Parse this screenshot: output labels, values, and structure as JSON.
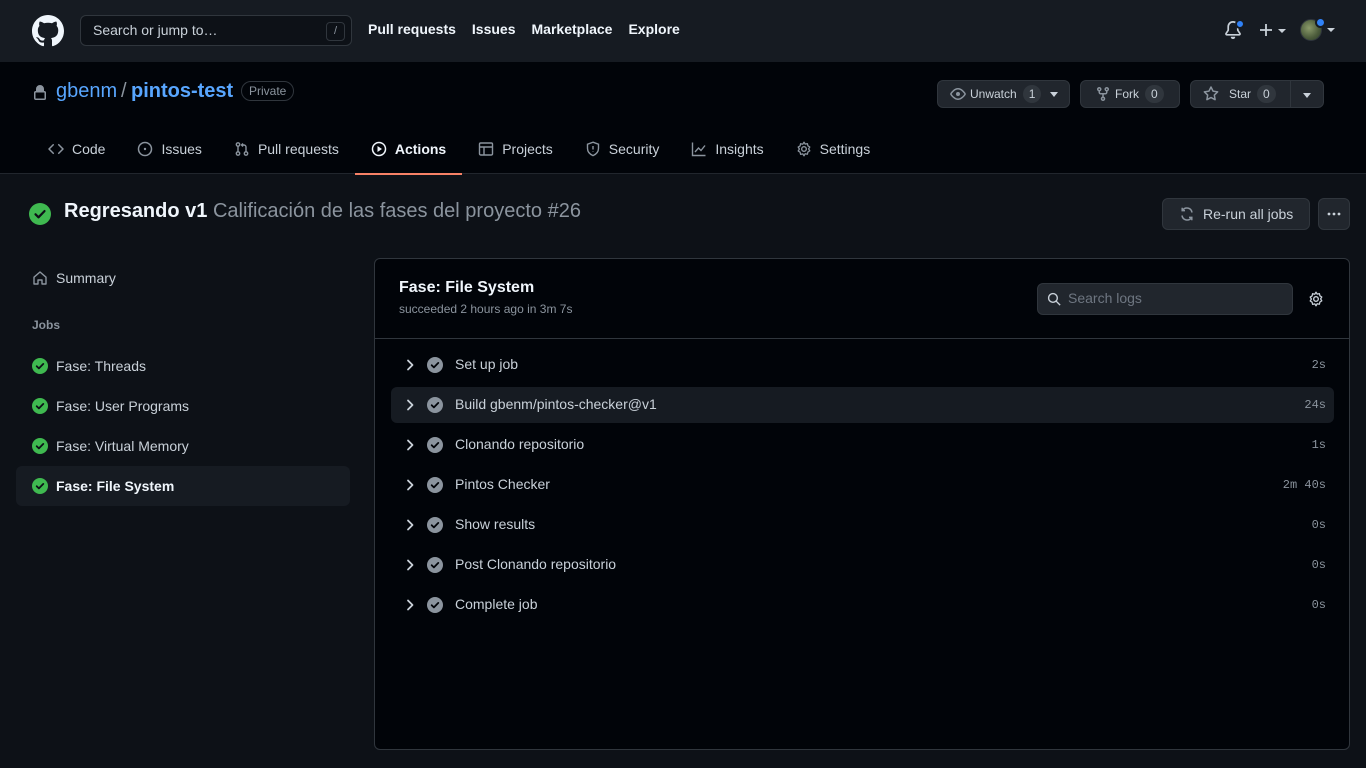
{
  "header": {
    "search_placeholder": "Search or jump to…",
    "search_shortcut": "/",
    "nav": [
      "Pull requests",
      "Issues",
      "Marketplace",
      "Explore"
    ]
  },
  "repo": {
    "owner": "gbenm",
    "separator": "/",
    "name": "pintos-test",
    "visibility": "Private",
    "watch_label": "Unwatch",
    "watch_count": "1",
    "fork_label": "Fork",
    "fork_count": "0",
    "star_label": "Star",
    "star_count": "0"
  },
  "tabs": [
    {
      "label": "Code",
      "icon": "code-icon"
    },
    {
      "label": "Issues",
      "icon": "issue-icon"
    },
    {
      "label": "Pull requests",
      "icon": "pull-request-icon"
    },
    {
      "label": "Actions",
      "icon": "play-icon",
      "active": true
    },
    {
      "label": "Projects",
      "icon": "table-icon"
    },
    {
      "label": "Security",
      "icon": "shield-icon"
    },
    {
      "label": "Insights",
      "icon": "graph-icon"
    },
    {
      "label": "Settings",
      "icon": "gear-icon"
    }
  ],
  "run": {
    "commit_title": "Regresando v1",
    "workflow": "Calificación de las fases del proyecto #26",
    "rerun_label": "Re-run all jobs"
  },
  "sidebar": {
    "summary_label": "Summary",
    "jobs_heading": "Jobs",
    "jobs": [
      {
        "label": "Fase: Threads",
        "selected": false
      },
      {
        "label": "Fase: User Programs",
        "selected": false
      },
      {
        "label": "Fase: Virtual Memory",
        "selected": false
      },
      {
        "label": "Fase: File System",
        "selected": true
      }
    ]
  },
  "job": {
    "title": "Fase: File System",
    "meta": "succeeded 2 hours ago in 3m 7s",
    "search_placeholder": "Search logs",
    "steps": [
      {
        "name": "Set up job",
        "duration": "2s"
      },
      {
        "name": "Build gbenm/pintos-checker@v1",
        "duration": "24s",
        "highlighted": true
      },
      {
        "name": "Clonando repositorio",
        "duration": "1s"
      },
      {
        "name": "Pintos Checker",
        "duration": "2m 40s"
      },
      {
        "name": "Show results",
        "duration": "0s"
      },
      {
        "name": "Post Clonando repositorio",
        "duration": "0s"
      },
      {
        "name": "Complete job",
        "duration": "0s"
      }
    ]
  },
  "colors": {
    "success": "#3fb950",
    "link": "#58a6ff",
    "active_tab_underline": "#f78166",
    "notification": "#2f81f7"
  }
}
